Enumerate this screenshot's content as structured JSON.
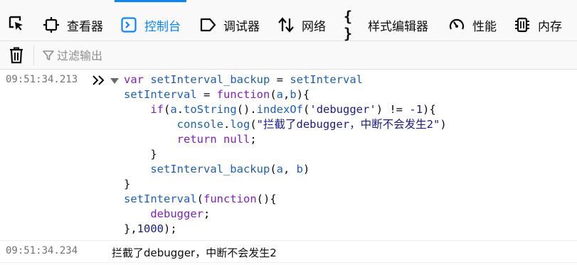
{
  "tabs": [
    {
      "id": "inspector",
      "label": "查看器",
      "icon": "inspector-icon"
    },
    {
      "id": "console",
      "label": "控制台",
      "icon": "console-icon",
      "active": true
    },
    {
      "id": "debugger",
      "label": "调试器",
      "icon": "debugger-icon"
    },
    {
      "id": "network",
      "label": "网络",
      "icon": "network-arrows-icon"
    },
    {
      "id": "style-editor",
      "label": "样式编辑器",
      "icon": "braces-icon"
    },
    {
      "id": "performance",
      "label": "性能",
      "icon": "gauge-icon"
    },
    {
      "id": "memory",
      "label": "内存",
      "icon": "chip-icon"
    }
  ],
  "toolbar": {
    "filter_placeholder": "过滤输出"
  },
  "console": {
    "input_entry": {
      "timestamp": "09:51:34.213",
      "code_lines": [
        "var setInterval_backup = setInterval",
        "setInterval = function(a,b){",
        "    if(a.toString().indexOf('debugger') != -1){",
        "        console.log(\"拦截了debugger，中断不会发生2\")",
        "        return null;",
        "    }",
        "    setInterval_backup(a, b)",
        "}",
        "setInterval(function(){",
        "    debugger;",
        "},1000);"
      ]
    },
    "log_entry": {
      "timestamp": "09:51:34.234",
      "text": "拦截了debugger，中断不会发生2"
    }
  },
  "colors": {
    "accent": "#0a84ff",
    "keyword": "#7f1fbf",
    "identifier": "#1c5fb8",
    "string": "#1a1a8e",
    "timestamp": "#737373"
  }
}
